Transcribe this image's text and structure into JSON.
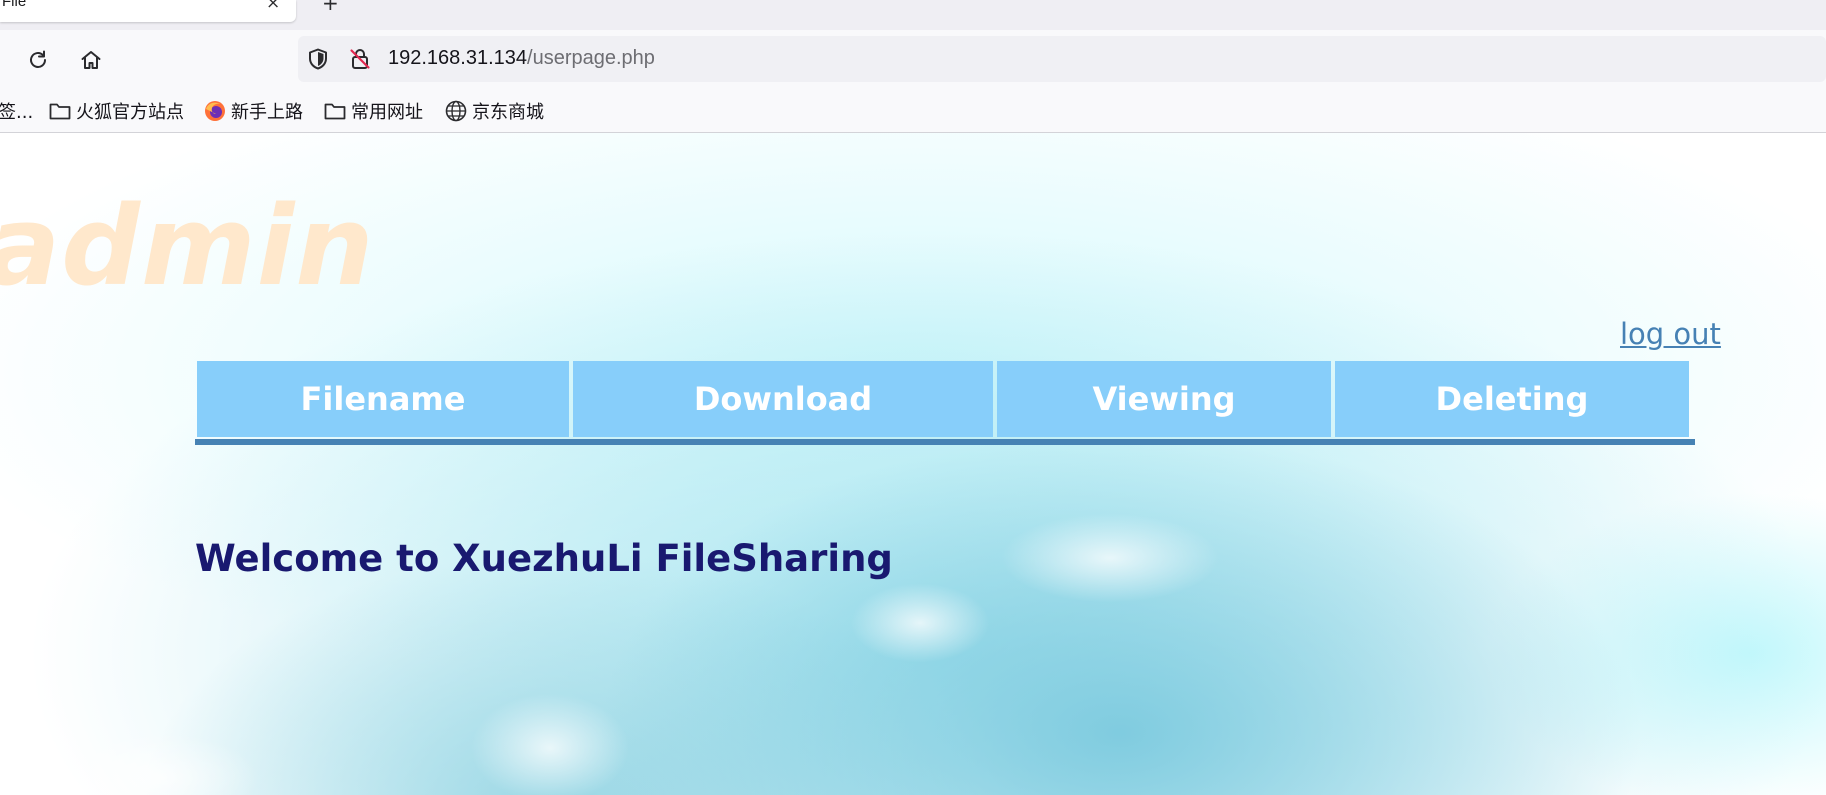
{
  "browser": {
    "tab_title": "File",
    "tab_close": "×",
    "new_tab": "+",
    "url_host": "192.168.31.134",
    "url_path": "/userpage.php",
    "bookmarks": [
      {
        "label": "签...",
        "icon": "none"
      },
      {
        "label": "火狐官方站点",
        "icon": "folder-icon"
      },
      {
        "label": "新手上路",
        "icon": "firefox-icon"
      },
      {
        "label": "常用网址",
        "icon": "folder-icon"
      },
      {
        "label": "京东商城",
        "icon": "globe-icon"
      }
    ]
  },
  "page": {
    "username": "admin",
    "logout_label": "log out",
    "table": {
      "headers": [
        "Filename",
        "Download",
        "Viewing",
        "Deleting"
      ]
    },
    "welcome": "Welcome to XuezhuLi FileSharing"
  },
  "colors": {
    "header_bg": "#87cefa",
    "header_rule": "#4682b4",
    "welcome_text": "#191970",
    "username_text": "#ffe8cc",
    "logout_link": "#4681b4"
  }
}
